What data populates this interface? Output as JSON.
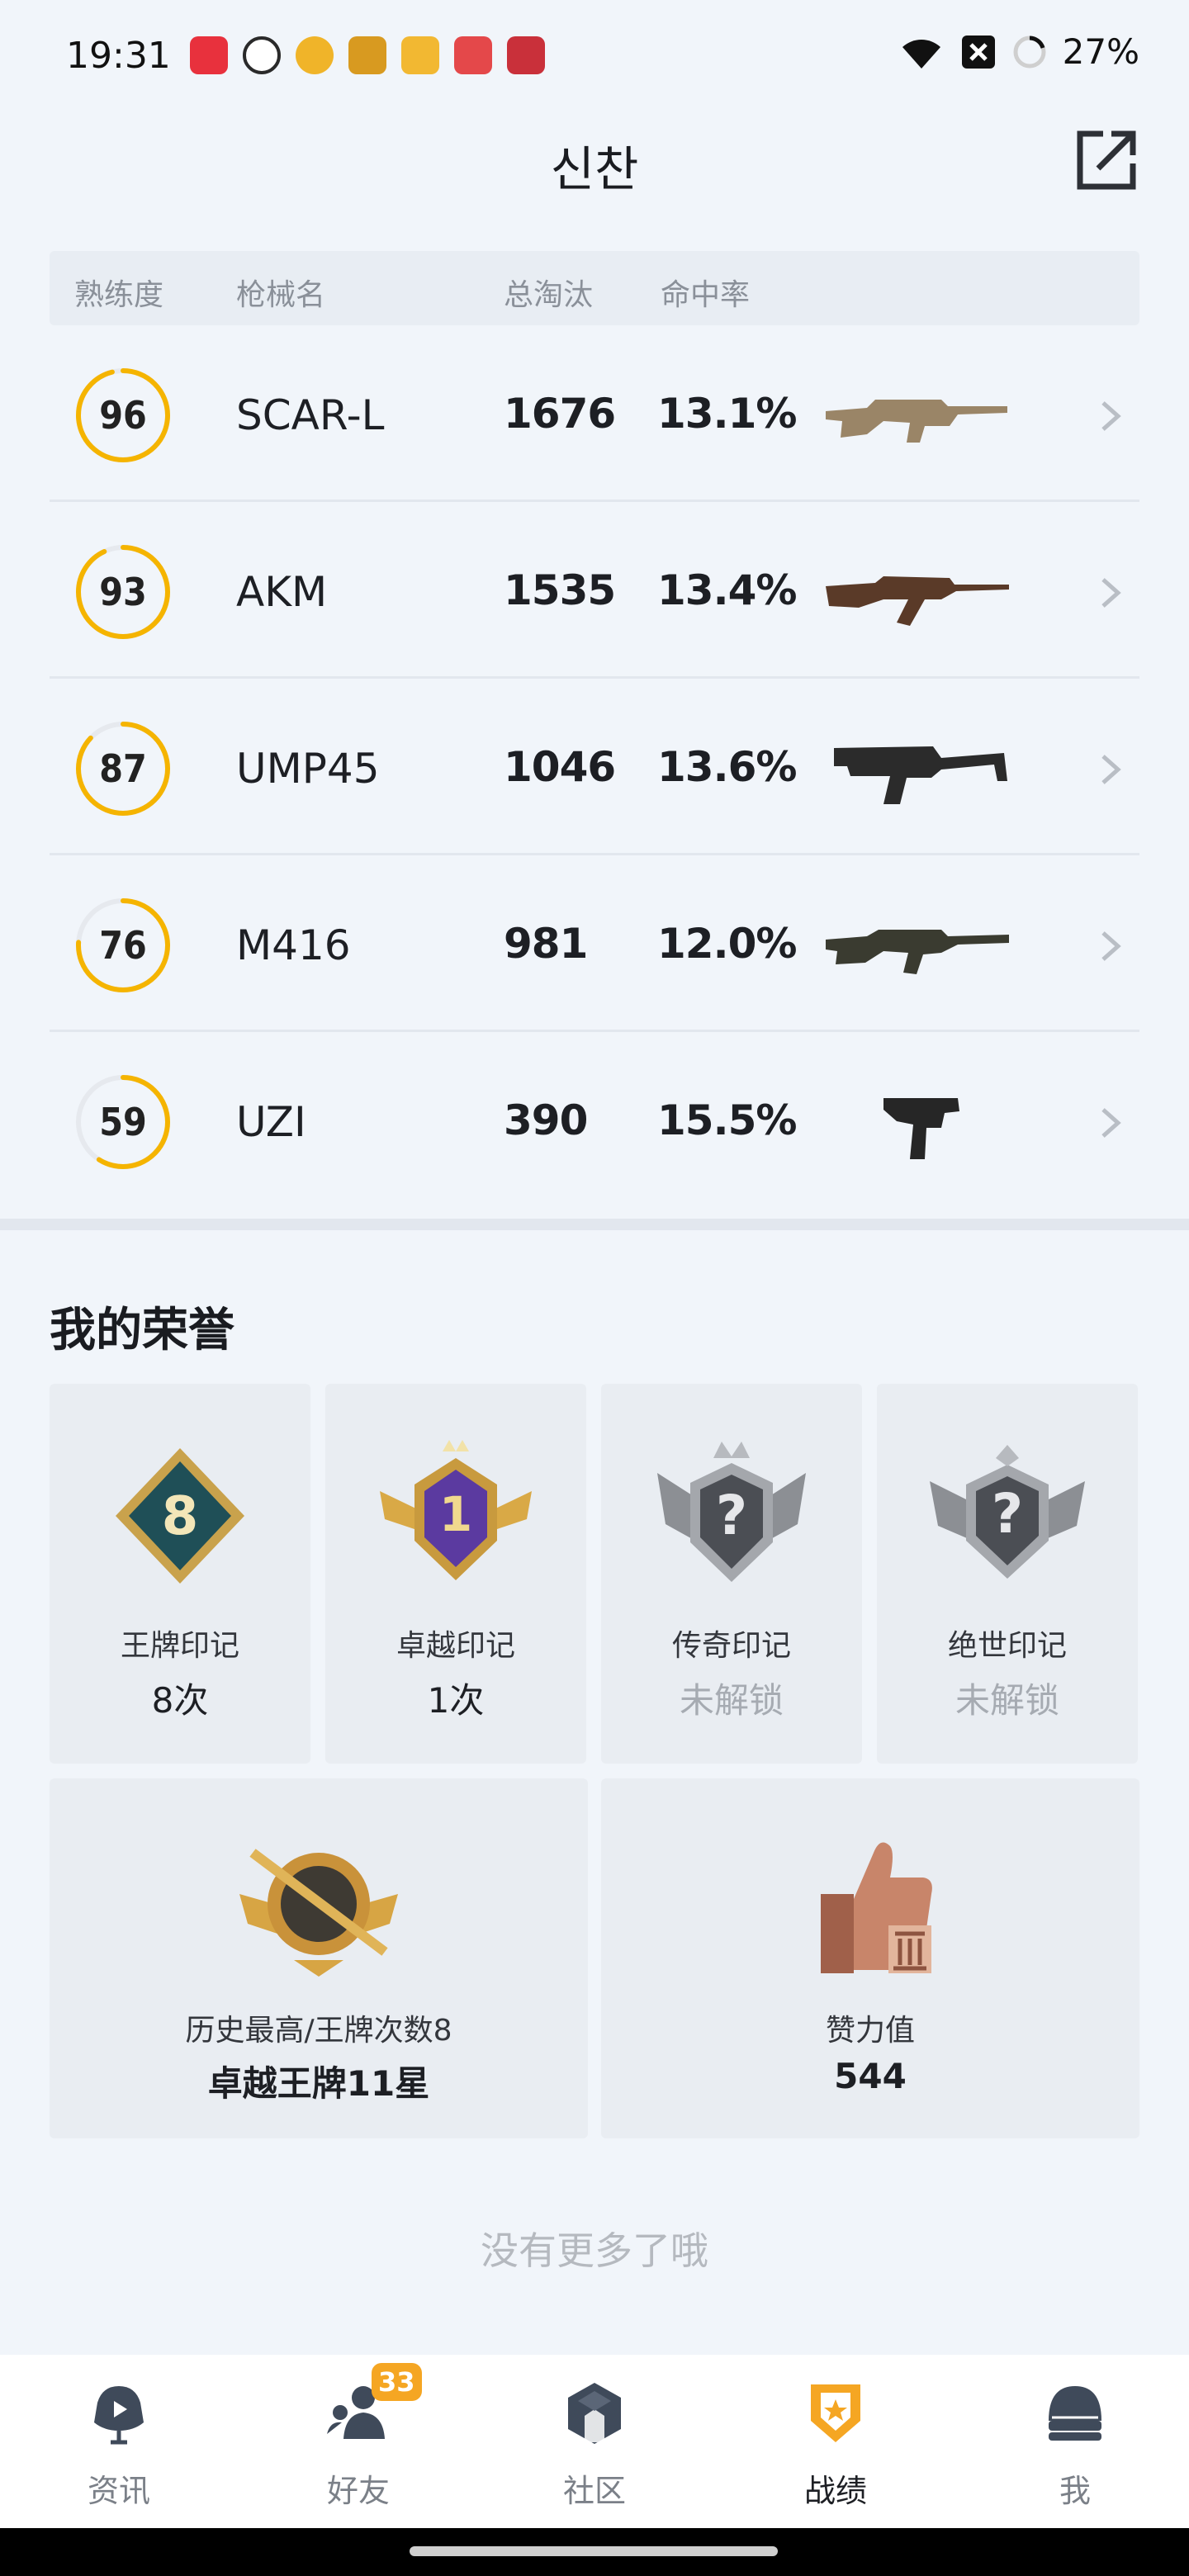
{
  "status_bar": {
    "time": "19:31",
    "battery": "27%",
    "app_icon_colors": [
      "#e8313d",
      "#2a2a2a",
      "#f0b429",
      "#d89a20",
      "#f2b832",
      "#e4484a",
      "#c9303a"
    ]
  },
  "header": {
    "title": "신찬",
    "share_icon": "share-external-icon"
  },
  "table": {
    "headers": [
      "熟练度",
      "枪械名",
      "总淘汰",
      "命中率"
    ],
    "rows": [
      {
        "proficiency": "96",
        "name": "SCAR-L",
        "kills": "1676",
        "accuracy": "13.1%",
        "gun_color": "#9a8567",
        "gun_icon": "scar-l-rifle-icon"
      },
      {
        "proficiency": "93",
        "name": "AKM",
        "kills": "1535",
        "accuracy": "13.4%",
        "gun_color": "#5a3a28",
        "gun_icon": "akm-rifle-icon"
      },
      {
        "proficiency": "87",
        "name": "UMP45",
        "kills": "1046",
        "accuracy": "13.6%",
        "gun_color": "#2b2b2b",
        "gun_icon": "ump45-smg-icon"
      },
      {
        "proficiency": "76",
        "name": "M416",
        "kills": "981",
        "accuracy": "12.0%",
        "gun_color": "#3a3b30",
        "gun_icon": "m416-rifle-icon"
      },
      {
        "proficiency": "59",
        "name": "UZI",
        "kills": "390",
        "accuracy": "15.5%",
        "gun_color": "#262626",
        "gun_icon": "uzi-smg-icon"
      }
    ],
    "ring_color": "#f5b400",
    "ring_track": "#e6e9ee"
  },
  "honors": {
    "title": "我的荣誉",
    "cards": [
      {
        "label": "王牌印记",
        "value": "8次",
        "locked": false,
        "badge_number": "8",
        "badge_icon": "ace-mark-badge-icon"
      },
      {
        "label": "卓越印记",
        "value": "1次",
        "locked": false,
        "badge_number": "1",
        "badge_icon": "excellence-mark-badge-icon"
      },
      {
        "label": "传奇印记",
        "value": "未解锁",
        "locked": true,
        "badge_number": "?",
        "badge_icon": "legend-mark-badge-icon"
      },
      {
        "label": "绝世印记",
        "value": "未解锁",
        "locked": true,
        "badge_number": "?",
        "badge_icon": "peerless-mark-badge-icon"
      }
    ],
    "wide_cards": [
      {
        "label": "历史最高/王牌次数8",
        "value": "卓越王牌11星",
        "badge_icon": "rank-badge-icon"
      },
      {
        "label": "赞力值",
        "value": "544",
        "badge_icon": "thumbs-up-icon"
      }
    ]
  },
  "footer_text": "没有更多了哦",
  "bottom_nav": {
    "items": [
      {
        "label": "资讯",
        "icon": "news-icon",
        "active": false
      },
      {
        "label": "好友",
        "icon": "friends-icon",
        "active": false,
        "badge": "33"
      },
      {
        "label": "社区",
        "icon": "community-icon",
        "active": false
      },
      {
        "label": "战绩",
        "icon": "record-icon",
        "active": true
      },
      {
        "label": "我",
        "icon": "profile-helmet-icon",
        "active": false
      }
    ],
    "active_color": "#f5a623"
  }
}
